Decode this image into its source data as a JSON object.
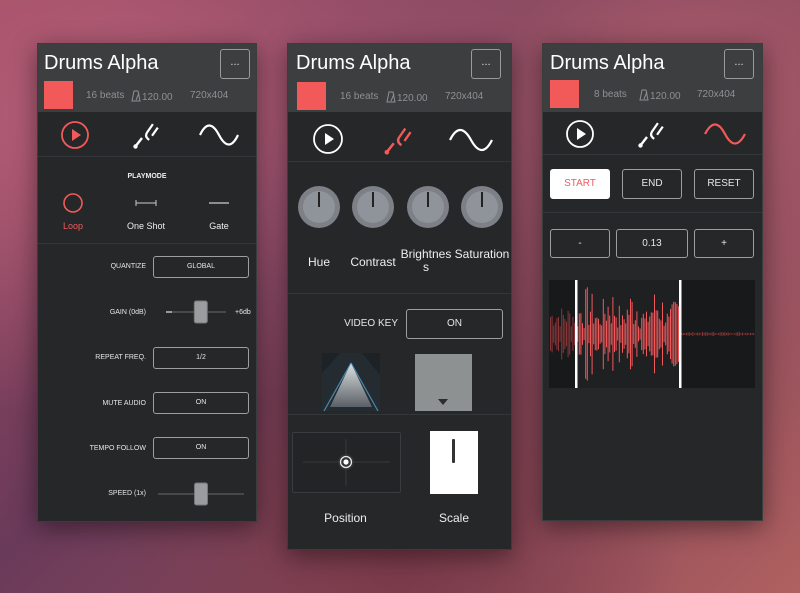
{
  "colors": {
    "accent": "#f25a5a",
    "panel": "#252729",
    "header": "#3c3e40"
  },
  "panels": [
    {
      "title": "Drums Alpha",
      "more": "...",
      "beats": "16 beats",
      "bpm": "120.00",
      "resolution": "720x404",
      "playmode": {
        "heading": "PLAYMODE",
        "options": [
          "Loop",
          "One Shot",
          "Gate"
        ]
      },
      "settings": {
        "quantize_label": "QUANTIZE",
        "quantize_value": "GLOBAL",
        "gain_label": "GAIN (0dB)",
        "gain_max": "+6db",
        "gain_level": 0.55,
        "repeat_label": "REPEAT FREQ.",
        "repeat_value": "1/2",
        "mute_label": "MUTE AUDIO",
        "mute_value": "ON",
        "tempo_label": "TEMPO FOLLOW",
        "tempo_value": "ON",
        "speed_label": "SPEED (1x)",
        "speed_level": 0.5
      }
    },
    {
      "title": "Drums Alpha",
      "more": "...",
      "beats": "16 beats",
      "bpm": "120.00",
      "resolution": "720x404",
      "knobs": [
        "Hue",
        "Contrast",
        "Brightness",
        "Saturation"
      ],
      "video_key_label": "VIDEO KEY",
      "video_key_value": "ON",
      "position_label": "Position",
      "scale_label": "Scale"
    },
    {
      "title": "Drums Alpha",
      "more": "...",
      "beats": "8 beats",
      "bpm": "120.00",
      "resolution": "720x404",
      "start": "START",
      "end": "END",
      "reset": "RESET",
      "minus": "-",
      "value": "0.13",
      "plus": "+"
    }
  ],
  "icons": [
    "play-icon",
    "tuning-fork-icon",
    "sine-wave-icon",
    "metronome-icon"
  ]
}
